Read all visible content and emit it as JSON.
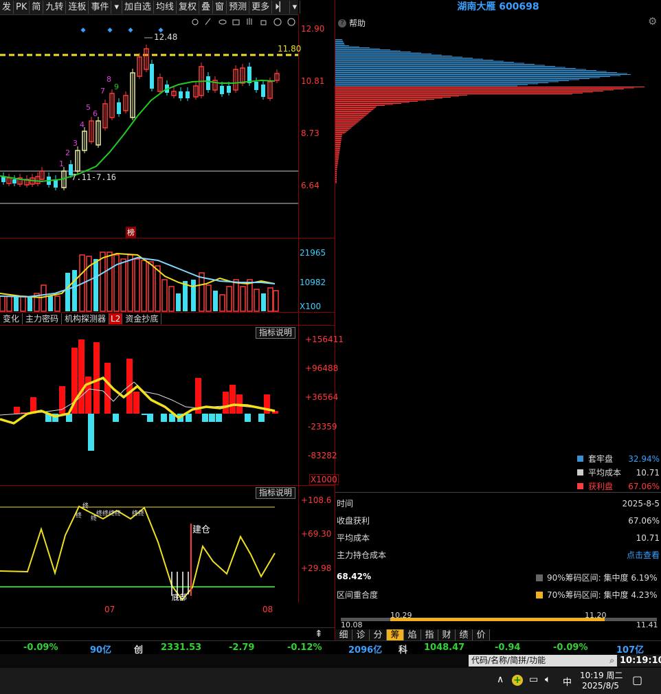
{
  "toolbar": {
    "items": [
      "发",
      "PK",
      "简",
      "九转",
      "连板",
      "事件",
      "加自选",
      "均线",
      "复权",
      "叠",
      "窗",
      "预测",
      "更多"
    ]
  },
  "stock_title": "湖南大雁 600698",
  "help_label": "帮助",
  "main_chart": {
    "price_labels": [
      "12.90",
      "10.81",
      "8.73",
      "6.64"
    ],
    "high_label": "12.48",
    "ref_label": "11.80",
    "range_label": "7.11-7.16",
    "rank_badge": "榜",
    "count_labels": [
      "1",
      "2",
      "3",
      "4",
      "5",
      "6",
      "7",
      "8",
      "9"
    ],
    "date_labels": [
      "07",
      "08"
    ]
  },
  "volume": {
    "labels": [
      "21965",
      "10982",
      "X100"
    ]
  },
  "indicator_tabs": [
    "变化",
    "主力密码",
    "机构探测器",
    "L2",
    "资金抄底"
  ],
  "indicator_button": "指标说明",
  "flow": {
    "labels": [
      "+156411",
      "+96488",
      "+36564",
      "-23359",
      "-83282"
    ],
    "scale": "X1000"
  },
  "osc": {
    "labels": [
      "+108.6",
      "+69.30",
      "+29.98"
    ],
    "jiancang": "建仓",
    "bottom_text": "底部"
  },
  "chip_panel": {
    "legend": [
      {
        "label": "套牢盘",
        "value": "32.94%",
        "color": "#3a8fd0"
      },
      {
        "label": "平均成本",
        "value": "10.71",
        "color": "#cccccc"
      },
      {
        "label": "获利盘",
        "value": "67.06%",
        "color": "#ff3b3b"
      }
    ],
    "rows": [
      {
        "label": "时间",
        "value": "2025-8-5"
      },
      {
        "label": "收盘获利",
        "value": "67.06%"
      },
      {
        "label": "平均成本",
        "value": "10.71"
      },
      {
        "label": "主力持仓成本",
        "value": "点击查看"
      }
    ],
    "concentration": "68.42%",
    "overlap_label": "区间重合度",
    "r90": "90%筹码区间: 集中度  6.19%",
    "r70": "70%筹码区间: 集中度  4.23%",
    "bar_low": "10.08",
    "bar_inner_low": "10.29",
    "bar_inner_high": "11.20",
    "bar_high": "11.41"
  },
  "bottom_tabs": [
    "细",
    "诊",
    "分",
    "筹",
    "焰",
    "指",
    "财",
    "绩",
    "价"
  ],
  "ticker": [
    {
      "text": "-0.09%",
      "cls": "green"
    },
    {
      "text": "90亿",
      "cls": "blue"
    },
    {
      "text": "创",
      "cls": "white"
    },
    {
      "text": "2331.53",
      "cls": "green"
    },
    {
      "text": "-2.79",
      "cls": "green"
    },
    {
      "text": "-0.12%",
      "cls": "green"
    },
    {
      "text": "2096亿",
      "cls": "blue"
    },
    {
      "text": "科",
      "cls": "white"
    },
    {
      "text": "1048.47",
      "cls": "green"
    },
    {
      "text": "-0.94",
      "cls": "green"
    },
    {
      "text": "-0.09%",
      "cls": "green"
    },
    {
      "text": "107亿",
      "cls": "blue"
    }
  ],
  "search_placeholder": "代码/名称/简拼/功能",
  "clock": "10:19:10",
  "taskbar": {
    "ime": "中",
    "time": "10:19 周二",
    "date": "2025/8/5"
  }
}
